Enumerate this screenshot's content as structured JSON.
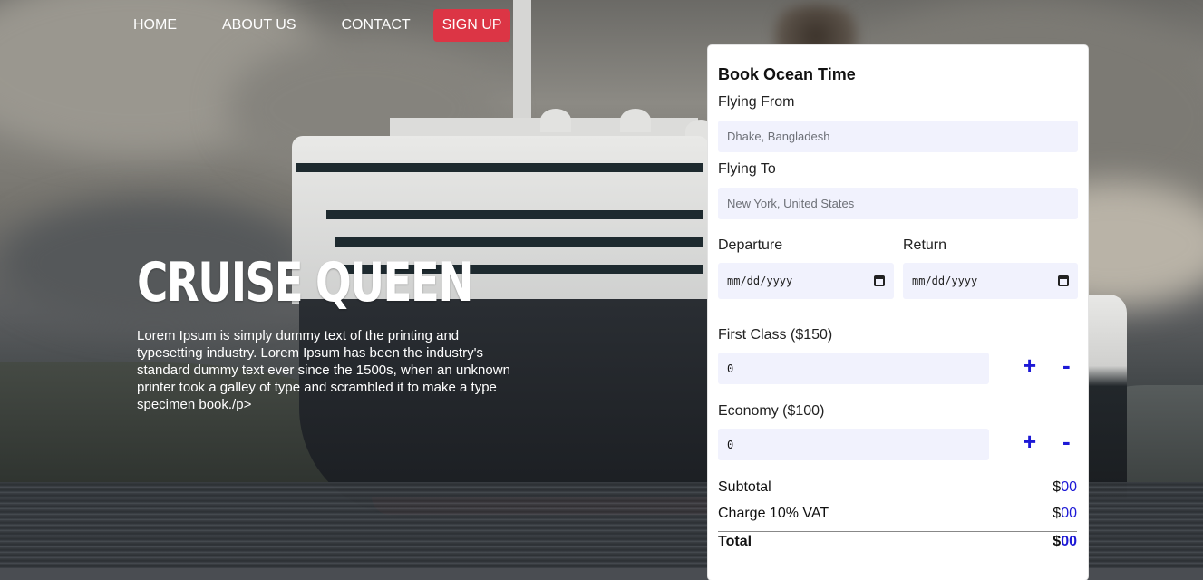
{
  "nav": {
    "items": [
      "HOME",
      "ABOUT US",
      "CONTACT"
    ],
    "signup": "SIGN UP"
  },
  "hero": {
    "title": "CRUISE QUEEN",
    "text": "Lorem Ipsum is simply dummy text of the printing and typesetting industry. Lorem Ipsum has been the industry's standard dummy text ever since the 1500s, when an unknown printer took a galley of type and scrambled it to make a type specimen book./p>"
  },
  "booking": {
    "title": "Book Ocean Time",
    "from_label": "Flying From",
    "from_placeholder": "Dhake, Bangladesh",
    "to_label": "Flying To",
    "to_placeholder": "New York, United States",
    "departure_label": "Departure",
    "return_label": "Return",
    "date_placeholder": "mm/dd/yyyy",
    "first_class_label": "First Class ($150)",
    "first_class_qty": "0",
    "economy_label": "Economy ($100)",
    "economy_qty": "0",
    "plus": "+",
    "minus": "-",
    "subtotal_label": "Subtotal",
    "vat_label": "Charge 10% VAT",
    "total_label": "Total",
    "currency": "$",
    "subtotal": "00",
    "vat": "00",
    "total": "00"
  },
  "colors": {
    "accent": "#1d19d6",
    "signup_bg": "#dc3545"
  },
  "icons": {
    "calendar": "calendar-icon"
  }
}
